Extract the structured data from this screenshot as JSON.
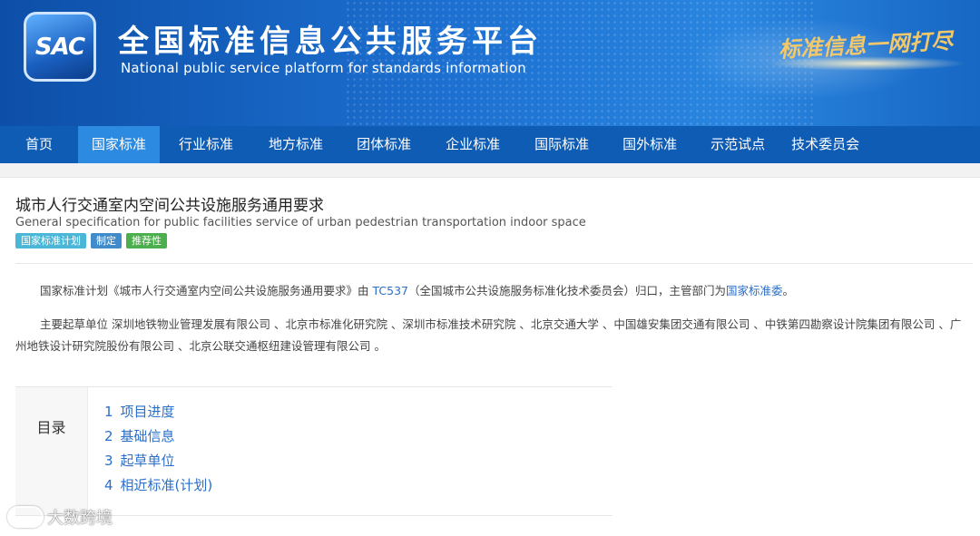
{
  "header": {
    "logo_text": "SAC",
    "title_cn": "全国标准信息公共服务平台",
    "title_en": "National public service platform  for standards information",
    "slogan": "标准信息一网打尽"
  },
  "nav": {
    "items": [
      {
        "label": "首页",
        "active": false
      },
      {
        "label": "国家标准",
        "active": true
      },
      {
        "label": "行业标准",
        "active": false
      },
      {
        "label": "地方标准",
        "active": false
      },
      {
        "label": "团体标准",
        "active": false
      },
      {
        "label": "企业标准",
        "active": false
      },
      {
        "label": "国际标准",
        "active": false
      },
      {
        "label": "国外标准",
        "active": false
      },
      {
        "label": "示范试点",
        "active": false
      },
      {
        "label": "技术委员会",
        "active": false
      }
    ]
  },
  "plan": {
    "title_cn": "城市人行交通室内空间公共设施服务通用要求",
    "title_en": "General specification for public facilities service of urban pedestrian transportation indoor space",
    "tags": [
      "国家标准计划",
      "制定",
      "推荐性"
    ],
    "intro": {
      "prefix": "国家标准计划《城市人行交通室内空间公共设施服务通用要求》由 ",
      "tc_code": "TC537",
      "middle": "（全国城市公共设施服务标准化技术委员会）归口，主管部门为",
      "authority": "国家标准委",
      "suffix": "。"
    },
    "drafters": "主要起草单位 深圳地铁物业管理发展有限公司 、北京市标准化研究院 、深圳市标准技术研究院 、北京交通大学 、中国雄安集团交通有限公司 、中铁第四勘察设计院集团有限公司 、广州地铁设计研究院股份有限公司 、北京公联交通枢纽建设管理有限公司 。"
  },
  "toc": {
    "label": "目录",
    "items": [
      {
        "num": "1",
        "label": "项目进度"
      },
      {
        "num": "2",
        "label": "基础信息"
      },
      {
        "num": "3",
        "label": "起草单位"
      },
      {
        "num": "4",
        "label": "相近标准(计划)"
      }
    ]
  },
  "watermark": {
    "text": "大数跨境"
  },
  "colors": {
    "nav_bg": "#0f5cb5",
    "nav_active": "#2c8be0",
    "link": "#2a6fc9",
    "tag_plan": "#4ab7d8",
    "tag_make": "#428bca",
    "tag_recommend": "#4cae4c"
  }
}
